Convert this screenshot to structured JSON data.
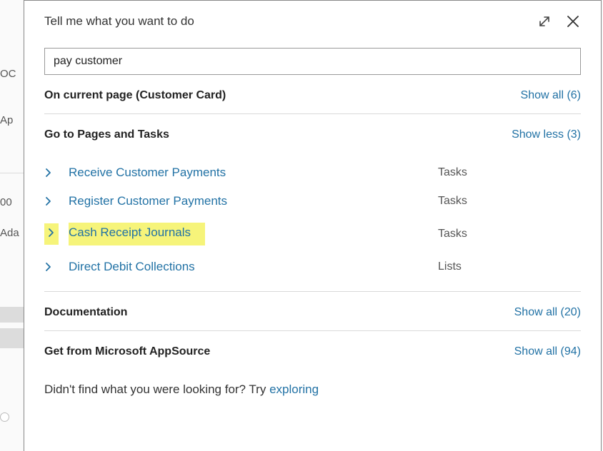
{
  "background": {
    "partial0": "OC",
    "partial1": "Ap",
    "partial2": "00",
    "partial3": "Ada"
  },
  "header": {
    "title": "Tell me what you want to do"
  },
  "search": {
    "value": "pay customer",
    "placeholder": ""
  },
  "sections": {
    "currentPage": {
      "title": "On current page (Customer Card)",
      "action": "Show all (6)"
    },
    "pagesTasks": {
      "title": "Go to Pages and Tasks",
      "action": "Show less (3)",
      "items": [
        {
          "label": "Receive Customer Payments",
          "type": "Tasks",
          "highlighted": false
        },
        {
          "label": "Register Customer Payments",
          "type": "Tasks",
          "highlighted": false
        },
        {
          "label": "Cash Receipt Journals",
          "type": "Tasks",
          "highlighted": true
        },
        {
          "label": "Direct Debit Collections",
          "type": "Lists",
          "highlighted": false
        }
      ]
    },
    "documentation": {
      "title": "Documentation",
      "action": "Show all (20)"
    },
    "appsource": {
      "title": "Get from Microsoft AppSource",
      "action": "Show all (94)"
    }
  },
  "footer": {
    "prefix": "Didn't find what you were looking for? Try ",
    "link": "exploring"
  }
}
